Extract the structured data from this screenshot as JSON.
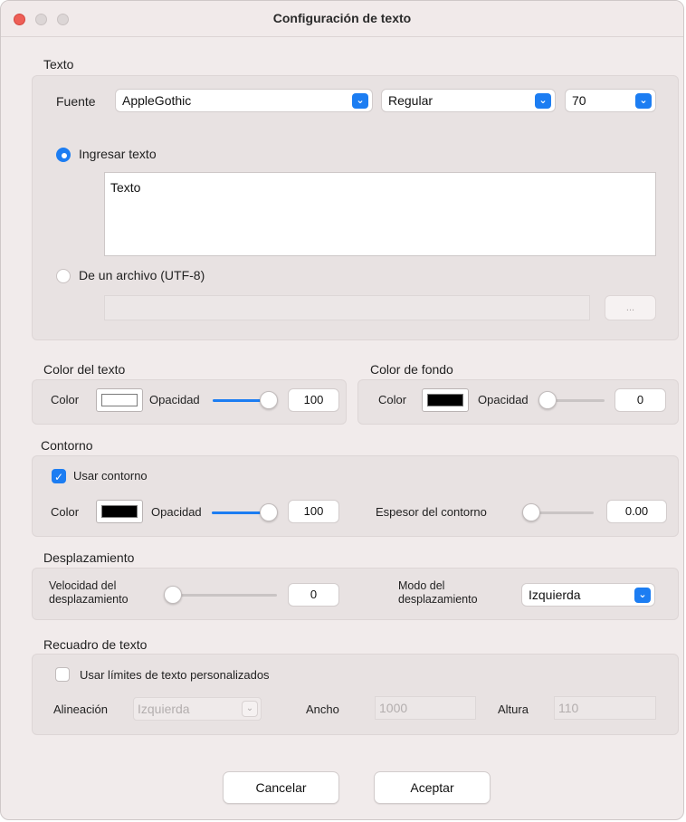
{
  "window": {
    "title": "Configuración de texto"
  },
  "texto": {
    "section_label": "Texto",
    "fuente_label": "Fuente",
    "font_family": "AppleGothic",
    "font_style": "Regular",
    "font_size": "70",
    "radio_ingresar_label": "Ingresar texto",
    "text_value": "Texto",
    "radio_archivo_label": "De un archivo (UTF-8)",
    "browse_label": "..."
  },
  "color_texto": {
    "section_label": "Color del texto",
    "color_label": "Color",
    "swatch_color": "#ffffff",
    "opacity_label": "Opacidad",
    "opacity_value": "100",
    "opacity_fraction": 1.0
  },
  "color_fondo": {
    "section_label": "Color de fondo",
    "color_label": "Color",
    "swatch_color": "#000000",
    "opacity_label": "Opacidad",
    "opacity_value": "0",
    "opacity_fraction": 0.0
  },
  "contorno": {
    "section_label": "Contorno",
    "usar_label": "Usar contorno",
    "usar_checked": true,
    "color_label": "Color",
    "swatch_color": "#000000",
    "opacity_label": "Opacidad",
    "opacity_value": "100",
    "opacity_fraction": 1.0,
    "espesor_label": "Espesor del contorno",
    "espesor_value": "0.00",
    "espesor_fraction": 0.0
  },
  "desplazamiento": {
    "section_label": "Desplazamiento",
    "velocidad_label_1": "Velocidad del",
    "velocidad_label_2": "desplazamiento",
    "velocidad_value": "0",
    "velocidad_fraction": 0.0,
    "modo_label_1": "Modo del",
    "modo_label_2": "desplazamiento",
    "modo_value": "Izquierda"
  },
  "recuadro": {
    "section_label": "Recuadro de texto",
    "usar_limites_label": "Usar límites de texto personalizados",
    "usar_limites_checked": false,
    "alineacion_label": "Alineación",
    "alineacion_value": "Izquierda",
    "ancho_label": "Ancho",
    "ancho_value": "1000",
    "altura_label": "Altura",
    "altura_value": "110"
  },
  "buttons": {
    "cancel_label": "Cancelar",
    "accept_label": "Aceptar"
  },
  "colors": {
    "accent": "#1c7df2",
    "close": "#ee5f57"
  },
  "icons": {
    "dropdown": "chevron-down-icon",
    "check": "checkmark-icon"
  }
}
